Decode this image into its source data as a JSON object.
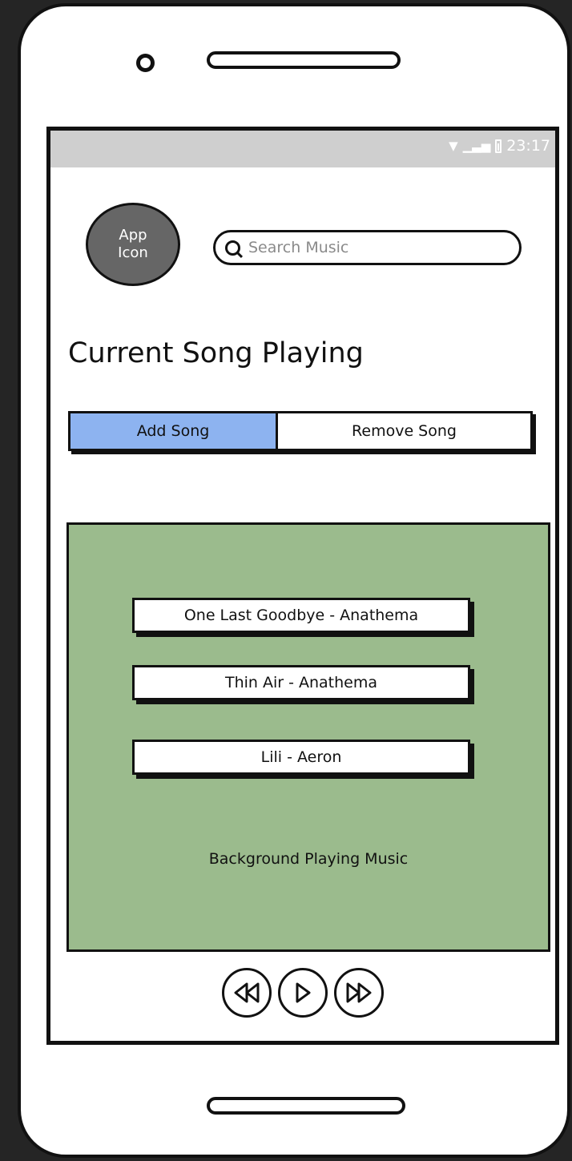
{
  "status_bar": {
    "time": "23:17",
    "icons": [
      "wifi-icon",
      "signal-icon",
      "battery-icon"
    ]
  },
  "header": {
    "app_icon_label": "App\nIcon",
    "search": {
      "placeholder": "Search Music",
      "value": ""
    }
  },
  "main": {
    "title": "Current Song Playing",
    "tabs": [
      {
        "label": "Add Song",
        "active": true
      },
      {
        "label": "Remove Song",
        "active": false
      }
    ],
    "songs": [
      {
        "label": "One Last Goodbye - Anathema"
      },
      {
        "label": "Thin Air - Anathema"
      },
      {
        "label": "Lili - Aeron"
      }
    ],
    "background_label": "Background Playing Music"
  },
  "controls": [
    "rewind-icon",
    "play-icon",
    "fast-forward-icon"
  ],
  "colors": {
    "active_tab": "#8db3f0",
    "panel": "#9bbb8d",
    "app_icon": "#666666",
    "status_bar": "#cfcfcf"
  }
}
